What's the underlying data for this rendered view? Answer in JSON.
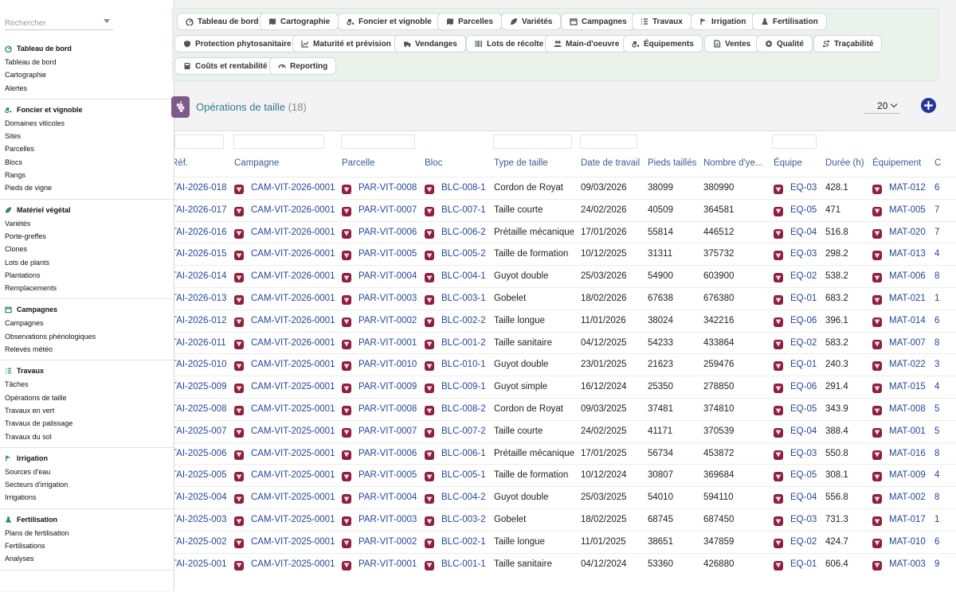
{
  "sidebar": {
    "search_placeholder": "Rechercher",
    "sections": [
      {
        "title": "Tableau de bord",
        "icon": "dashboard-icon",
        "items": [
          "Tableau de bord",
          "Cartographie",
          "Alertes"
        ]
      },
      {
        "title": "Foncier et vignoble",
        "icon": "tractor-icon",
        "items": [
          "Domaines viticoles",
          "Sites",
          "Parcelles",
          "Blocs",
          "Rangs",
          "Pieds de vigne"
        ]
      },
      {
        "title": "Matériel végétal",
        "icon": "leaf-icon",
        "items": [
          "Variétés",
          "Porte-greffes",
          "Clones",
          "Lots de plants",
          "Plantations",
          "Remplacements"
        ]
      },
      {
        "title": "Campagnes",
        "icon": "calendar-icon",
        "items": [
          "Campagnes",
          "Observations phénologiques",
          "Relevés météo"
        ]
      },
      {
        "title": "Travaux",
        "icon": "list-icon",
        "items": [
          "Tâches",
          "Opérations de taille",
          "Travaux en vert",
          "Travaux de palissage",
          "Travaux du sol"
        ]
      },
      {
        "title": "Irrigation",
        "icon": "flag-icon",
        "items": [
          "Sources d'eau",
          "Secteurs d'irrigation",
          "Irrigations"
        ]
      },
      {
        "title": "Fertilisation",
        "icon": "flask-icon",
        "items": [
          "Plans de fertilisation",
          "Fertilisations",
          "Analyses"
        ]
      }
    ]
  },
  "modules": [
    {
      "label": "Tableau de bord",
      "icon": "dashboard-icon"
    },
    {
      "label": "Cartographie",
      "icon": "map-icon"
    },
    {
      "label": "Foncier et vignoble",
      "icon": "tractor-icon"
    },
    {
      "label": "Parcelles",
      "icon": "map-icon"
    },
    {
      "label": "Variétés",
      "icon": "leaf-icon"
    },
    {
      "label": "Campagnes",
      "icon": "calendar-icon"
    },
    {
      "label": "Travaux",
      "icon": "list-icon"
    },
    {
      "label": "Irrigation",
      "icon": "flag-icon"
    },
    {
      "label": "Fertilisation",
      "icon": "flask-icon"
    },
    {
      "label": "Protection phytosanitaire",
      "icon": "shield-icon"
    },
    {
      "label": "Maturité et prévision",
      "icon": "chart-icon"
    },
    {
      "label": "Vendanges",
      "icon": "truck-icon"
    },
    {
      "label": "Lots de récolte",
      "icon": "barcode-icon"
    },
    {
      "label": "Main-d'oeuvre",
      "icon": "users-icon"
    },
    {
      "label": "Équipements",
      "icon": "tractor-icon"
    },
    {
      "label": "Ventes",
      "icon": "document-icon"
    },
    {
      "label": "Qualité",
      "icon": "badge-icon"
    },
    {
      "label": "Traçabilité",
      "icon": "route-icon"
    },
    {
      "label": "Coûts et rentabilité",
      "icon": "calculator-icon"
    },
    {
      "label": "Reporting",
      "icon": "gauge-icon"
    }
  ],
  "page": {
    "title": "Opérations de taille",
    "count": "(18)",
    "page_size": "20"
  },
  "table": {
    "columns": [
      "Réf.",
      "Campagne",
      "Parcelle",
      "Bloc",
      "Type de taille",
      "Date de travail",
      "Pieds taillés",
      "Nombre d'ye...",
      "Équipe",
      "Durée (h)",
      "Équipement",
      "C"
    ],
    "rows": [
      [
        "TAI-2026-018",
        "CAM-VIT-2026-0001",
        "PAR-VIT-0008",
        "BLC-008-1",
        "Cordon de Royat",
        "09/03/2026",
        "38099",
        "380990",
        "EQ-03",
        "428.1",
        "MAT-012",
        "6"
      ],
      [
        "TAI-2026-017",
        "CAM-VIT-2026-0001",
        "PAR-VIT-0007",
        "BLC-007-1",
        "Taille courte",
        "24/02/2026",
        "40509",
        "364581",
        "EQ-05",
        "471",
        "MAT-005",
        "7"
      ],
      [
        "TAI-2026-016",
        "CAM-VIT-2026-0001",
        "PAR-VIT-0006",
        "BLC-006-2",
        "Prétaille mécanique",
        "17/01/2026",
        "55814",
        "446512",
        "EQ-04",
        "516.8",
        "MAT-020",
        "7"
      ],
      [
        "TAI-2026-015",
        "CAM-VIT-2026-0001",
        "PAR-VIT-0005",
        "BLC-005-2",
        "Taille de formation",
        "10/12/2025",
        "31311",
        "375732",
        "EQ-03",
        "298.2",
        "MAT-013",
        "4"
      ],
      [
        "TAI-2026-014",
        "CAM-VIT-2026-0001",
        "PAR-VIT-0004",
        "BLC-004-1",
        "Guyot double",
        "25/03/2026",
        "54900",
        "603900",
        "EQ-02",
        "538.2",
        "MAT-006",
        "8"
      ],
      [
        "TAI-2026-013",
        "CAM-VIT-2026-0001",
        "PAR-VIT-0003",
        "BLC-003-1",
        "Gobelet",
        "18/02/2026",
        "67638",
        "676380",
        "EQ-01",
        "683.2",
        "MAT-021",
        "1"
      ],
      [
        "TAI-2026-012",
        "CAM-VIT-2026-0001",
        "PAR-VIT-0002",
        "BLC-002-2",
        "Taille longue",
        "11/01/2026",
        "38024",
        "342216",
        "EQ-06",
        "396.1",
        "MAT-014",
        "6"
      ],
      [
        "TAI-2026-011",
        "CAM-VIT-2026-0001",
        "PAR-VIT-0001",
        "BLC-001-2",
        "Taille sanitaire",
        "04/12/2025",
        "54233",
        "433864",
        "EQ-02",
        "583.2",
        "MAT-007",
        "8"
      ],
      [
        "TAI-2025-010",
        "CAM-VIT-2025-0001",
        "PAR-VIT-0010",
        "BLC-010-1",
        "Guyot double",
        "23/01/2025",
        "21623",
        "259476",
        "EQ-01",
        "240.3",
        "MAT-022",
        "3"
      ],
      [
        "TAI-2025-009",
        "CAM-VIT-2025-0001",
        "PAR-VIT-0009",
        "BLC-009-1",
        "Guyot simple",
        "16/12/2024",
        "25350",
        "278850",
        "EQ-06",
        "291.4",
        "MAT-015",
        "4"
      ],
      [
        "TAI-2025-008",
        "CAM-VIT-2025-0001",
        "PAR-VIT-0008",
        "BLC-008-2",
        "Cordon de Royat",
        "09/03/2025",
        "37481",
        "374810",
        "EQ-05",
        "343.9",
        "MAT-008",
        "5"
      ],
      [
        "TAI-2025-007",
        "CAM-VIT-2025-0001",
        "PAR-VIT-0007",
        "BLC-007-2",
        "Taille courte",
        "24/02/2025",
        "41171",
        "370539",
        "EQ-04",
        "388.4",
        "MAT-001",
        "5"
      ],
      [
        "TAI-2025-006",
        "CAM-VIT-2025-0001",
        "PAR-VIT-0006",
        "BLC-006-1",
        "Prétaille mécanique",
        "17/01/2025",
        "56734",
        "453872",
        "EQ-03",
        "550.8",
        "MAT-016",
        "8"
      ],
      [
        "TAI-2025-005",
        "CAM-VIT-2025-0001",
        "PAR-VIT-0005",
        "BLC-005-1",
        "Taille de formation",
        "10/12/2024",
        "30807",
        "369684",
        "EQ-05",
        "308.1",
        "MAT-009",
        "4"
      ],
      [
        "TAI-2025-004",
        "CAM-VIT-2025-0001",
        "PAR-VIT-0004",
        "BLC-004-2",
        "Guyot double",
        "25/03/2025",
        "54010",
        "594110",
        "EQ-04",
        "556.8",
        "MAT-002",
        "8"
      ],
      [
        "TAI-2025-003",
        "CAM-VIT-2025-0001",
        "PAR-VIT-0003",
        "BLC-003-2",
        "Gobelet",
        "18/02/2025",
        "68745",
        "687450",
        "EQ-03",
        "731.3",
        "MAT-017",
        "1"
      ],
      [
        "TAI-2025-002",
        "CAM-VIT-2025-0001",
        "PAR-VIT-0002",
        "BLC-002-1",
        "Taille longue",
        "11/01/2025",
        "38651",
        "347859",
        "EQ-02",
        "424.7",
        "MAT-010",
        "6"
      ],
      [
        "TAI-2025-001",
        "CAM-VIT-2025-0001",
        "PAR-VIT-0001",
        "BLC-001-1",
        "Taille sanitaire",
        "04/12/2024",
        "53360",
        "426880",
        "EQ-01",
        "606.4",
        "MAT-003",
        "9"
      ]
    ]
  }
}
